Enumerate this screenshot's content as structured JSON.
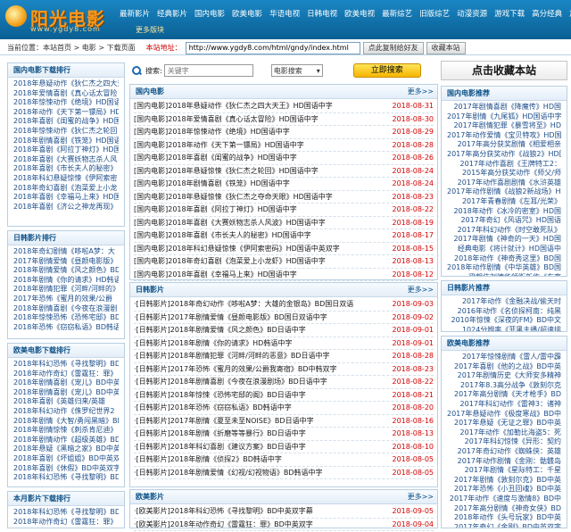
{
  "logo": {
    "title": "阳光电影",
    "url": "www.ygdy8.com"
  },
  "topnav": [
    "最新影片",
    "经典影片",
    "国内电影",
    "欧美电影",
    "华语电视",
    "日韩电视",
    "欧美电视",
    "最新综艺",
    "旧版综艺",
    "动漫资源",
    "游戏下载",
    "高分经典",
    "加入收藏"
  ],
  "subnav": "更多版块",
  "bar": {
    "location": "当前位置：本站首页 > 电影 > 下载页面",
    "address_label": "本站地址：",
    "address_value": "http://www.ygdy8.com/html/gndy/index.html",
    "copy_button": "点此复制给好友",
    "fav_button": "收藏本站"
  },
  "search": {
    "label": "搜索:",
    "placeholder": "关键字",
    "select_value": "电影搜索",
    "button": "立即搜索"
  },
  "fav_big": "点击收藏本站",
  "left": [
    {
      "title": "国内电影下载排行",
      "items": [
        "2018年悬疑动作《狄仁杰之四大天",
        "2018年爱情喜剧《真心话太冒险",
        "2018年惊悚动作《绝境》HD国语",
        "2018年动作《天下第一镖局》HD",
        "2018年喜剧《闺蜜的战争》HD国",
        "2018年惊悚动作《狄仁杰之轮回",
        "2018年剧情喜剧《铁笼》HD国语",
        "2018年喜剧《阿拉丁神灯》HD国",
        "2018年喜剧《大赛妖物志杀人风",
        "2018年喜剧《市长夫人的秘密》",
        "2018年科幻悬疑惊悚《伊阿索密",
        "2018年奇幻喜剧《泡菜爱上小龙",
        "2018年喜剧《幸福马上来》HD国",
        "2018年喜剧《济公之神龙再现》"
      ]
    },
    {
      "title": "日韩影片排行",
      "items": [
        "2018年奇幻剧情《哆啦A梦：大",
        "2017年剧情爱情《昼颜电影版》",
        "2018年剧情爱情《风之颜色》BD",
        "2018年剧情《你的请求》HD韩语",
        "2018年剧情犯罪《河畔/河畔的》",
        "2017年恐怖《蜜月的效果/公爵",
        "2018年剧情喜剧《今夜在浪漫剧",
        "2018年惊悚恐怖《恐怖宅邸》BD",
        "2018年恐怖《窃窃私语》BD韩语"
      ]
    },
    {
      "title": "欧美电影下载排行",
      "items": [
        "2018年科幻恐怖《寻找黎明》BD",
        "2018年动作奇幻《雷霆狂：罪》",
        "2018年剧情喜剧《宠儿》BD中英",
        "2018年剧情喜剧《宠儿》BD中英",
        "2018年喜剧《英雄归来/英雄",
        "2018年科幻动作《侏罗纪世界2",
        "2018年剧情《大智/勇闯黑暗》BD",
        "2018年剧情惊悚《刺杀肯尼迪》",
        "2018年剧情动作《超级英雄》BD",
        "2018年悬疑《黑暗之家》BD中英",
        "2018年喜剧《坏姐姐》BD中英双",
        "2018年喜剧《休假》BD中英双字",
        "2018年科幻恐怖《寻找黎明》BD"
      ]
    },
    {
      "title": "本月影片下载排行",
      "items": [
        "2018年科幻恐怖《寻找黎明》BD",
        "2018年动作奇幻《雷霆狂：罪》"
      ]
    }
  ],
  "middle": [
    {
      "title": "国内电影",
      "more": "更多>>",
      "rows": [
        [
          "[国内电影]2018年悬疑动作《狄仁杰之四大天王》HD国语中字",
          "2018-08-31"
        ],
        [
          "[国内电影]2018年爱情喜剧《真心话太冒险》HD国语中字",
          "2018-08-30"
        ],
        [
          "[国内电影]2018年惊悚动作《绝境》HD国语中字",
          "2018-08-29"
        ],
        [
          "[国内电影]2018年动作《天下第一镖局》HD国语中字",
          "2018-08-28"
        ],
        [
          "[国内电影]2018年喜剧《闺蜜的战争》HD国语中字",
          "2018-08-26"
        ],
        [
          "[国内电影]2018年悬疑惊悚《狄仁杰之轮回》HD国语中字",
          "2018-08-24"
        ],
        [
          "[国内电影]2018年剧情喜剧《铁笼》HD国语中字",
          "2018-08-24"
        ],
        [
          "[国内电影]2018年悬疑惊悚《狄仁杰之夺命天眼》HD国语中字",
          "2018-08-23"
        ],
        [
          "[国内电影]2018年喜剧《阿拉丁神灯》HD国语中字",
          "2018-08-22"
        ],
        [
          "[国内电影]2018年喜剧《大赛妖物志杀人风波》HD国语中字",
          "2018-08-19"
        ],
        [
          "[国内电影]2018年喜剧《市长夫人的秘密》HD国语中字",
          "2018-08-17"
        ],
        [
          "[国内电影]2018年科幻悬疑惊悚《伊阿索密码》HD国语中英双字",
          "2018-08-15"
        ],
        [
          "[国内电影]2018年奇幻喜剧《泡菜爱上小龙虾》HD国语中字",
          "2018-08-13"
        ],
        [
          "[国内电影]2018年喜剧《幸福马上来》HD国语中字",
          "2018-08-12"
        ]
      ]
    },
    {
      "title": "日韩影片",
      "more": "更多>>",
      "rows": [
        [
          "·[日韩影片]2018年奇幻动作《哆啦A梦：大雄的金银岛》BD国日双语",
          "2018-09-03"
        ],
        [
          "·[日韩影片]2017年剧情爱情《昼颜电影版》BD国日双语中字",
          "2018-09-02"
        ],
        [
          "·[日韩影片]2018年剧情爱情《风之颜色》BD日语中字",
          "2018-09-01"
        ],
        [
          "·[日韩影片]2018年剧情《你的请求》HD韩语中字",
          "2018-09-01"
        ],
        [
          "·[日韩影片]2018年剧情犯罪《河畔/河畔的恶意》BD日语中字",
          "2018-08-28"
        ],
        [
          "·[日韩影片]2017年恐怖《蜜月的效果/公爵我寄宿》BD中韩双字",
          "2018-08-23"
        ],
        [
          "·[日韩影片]2018年剧情喜剧《今夜在浪漫剧场》BD日语中字",
          "2018-08-22"
        ],
        [
          "·[日韩影片]2018年惊悚《恐怖宅邸的阁》BD日语中字",
          "2018-08-21"
        ],
        [
          "·[日韩影片]2018年恐怖《窃窃私语》BD韩语中字",
          "2018-08-20"
        ],
        [
          "·[日韩影片]2017年剧情《夏至未至NOISE》BD日语中字",
          "2018-08-16"
        ],
        [
          "·[日韩影片]2018年剧情《折磨等等暴行》BD日语中字",
          "2018-08-13"
        ],
        [
          "·[日韩影片]2018年科幻喜剧《建议方案》BD日语中字",
          "2018-08-10"
        ],
        [
          "·[日韩影片]2018年剧情《侦探2》BD韩语中字",
          "2018-08-05"
        ],
        [
          "·[日韩影片]2018年剧情爱情《幻视/幻视物语》BD韩语中字",
          "2018-08-05"
        ]
      ]
    },
    {
      "title": "欧美影片",
      "more": "更多>>",
      "rows": [
        [
          "·[欧美影片]2018年科幻恐怖《寻找黎明》BD中英双字幕",
          "2018-09-05"
        ],
        [
          "·[欧美影片]2018年动作奇幻《雷霆狂：罪》BD中英双字",
          "2018-09-04"
        ]
      ]
    }
  ],
  "right": [
    {
      "title": "国内电影推荐",
      "items": [
        "2017年剧情喜剧《降魔传》HD国",
        "2017年剧情《九尾狐》HD国语中字",
        "2017年剧情犯罪《暴雪将至》HD",
        "2017年动作爱情《宝贝特攻》HD国",
        "2017年高分获奖剧情《相爱相亲",
        "2017年高分获奖动作《战狼2》HD国",
        "2017年动作喜剧《王牌特工2：",
        "2015年高分获奖动作《师父/师",
        "2017年动作喜剧剧情《水浒英雄",
        "2017年动作剧情《战狼2新战场》HD",
        "2017年青春剧情《左耳/光荣》",
        "2018年动作《冰冷的密室》HD国",
        "2017年奇幻《风语咒》HD国语",
        "2017年科幻动作《时空敢死队》",
        "2017年剧情《神奇的一天》HD国",
        "经典电影《将计就计》HD国语中",
        "2018年动作《神奇秀这里》BD国",
        "2018年动作剧情《中华英雄》BD国",
        "梁朝伟刘德华领衔新作《东京"
      ]
    },
    {
      "title": "日韩影片推荐",
      "items": [
        "2017年动作《金融决战/偷天时",
        "2016年动作《名侦探柯南：纯黑",
        "2010年惊悚《深夜的FM》BD中文",
        "1024分辨率《菲黑主播/超速排",
        "2019年新动作《加油站被袭事件"
      ]
    },
    {
      "title": "欧美电影推荐",
      "items": [
        "2017年惊悚剧情《雷人/雷中霹",
        "2017年喜剧《他的之战》BD中英",
        "2017年剧情历史《大师安多精神",
        "2017年8.3高分战争《敦刻尔克",
        "2017年高分剧情《天才枪手》BD",
        "2017年科幻动作《雷神3：诸神",
        "2017年悬疑动作《极度寒战》BD中",
        "2017年悬疑《无证之罪》BD中英",
        "2017年动作《加勒比海盗5：死",
        "2017年科幻惊悚《异形：契约",
        "2017年奇幻动作《蜘蛛侠：英雄",
        "2017年动作剧情《金刚：骷髅岛",
        "2017年剧情《星际特工：千星",
        "2017年剧情《敦刻尔克》BD中英",
        "2017年恐怖《小丑回魂》BD中英",
        "2017年动作《速度与激情8》BD中",
        "2017年高分剧情《神奇女侠》BD",
        "2018年动作《头号玩家》BD中英",
        "2017年奇幻《金刚》BD中英双字",
        "2017年喜剧《摔跤吧爸爸》BD中英"
      ]
    }
  ]
}
